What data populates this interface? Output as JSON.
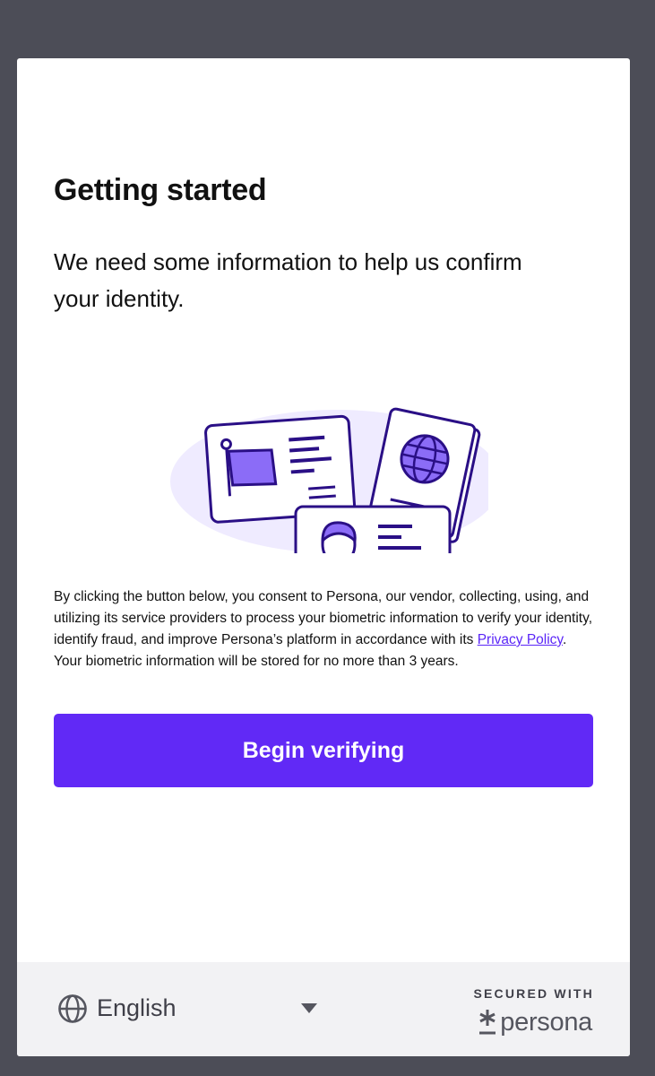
{
  "header": {
    "title": "Getting started",
    "subtitle": "We need some information to help us confirm your identity."
  },
  "illustration": {
    "icon": "id-documents-illustration"
  },
  "consent": {
    "before_link": "By clicking the button below, you consent to Persona, our vendor, collecting, using, and utilizing its service providers to process your biometric information to verify your identity, identify fraud, and improve Persona’s platform in accordance with its ",
    "link_text": "Privacy Policy",
    "after_link": ". Your biometric information will be stored for no more than 3 years."
  },
  "actions": {
    "begin_label": "Begin verifying"
  },
  "footer": {
    "language": "English",
    "secured_label": "SECURED WITH",
    "brand": "persona"
  },
  "colors": {
    "accent": "#6129f6",
    "illustration_stroke": "#2a0f86",
    "illustration_fill": "#8b6cf7",
    "illustration_bg": "#efebff"
  }
}
